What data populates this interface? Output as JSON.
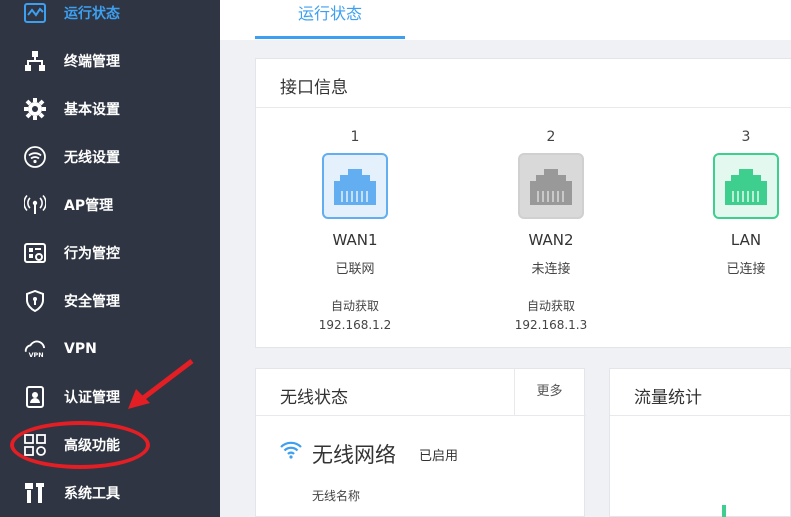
{
  "sidebar": {
    "items": [
      {
        "label": "运行状态",
        "icon": "chart-monitor-icon",
        "active": true
      },
      {
        "label": "终端管理",
        "icon": "network-tree-icon"
      },
      {
        "label": "基本设置",
        "icon": "gear-icon"
      },
      {
        "label": "无线设置",
        "icon": "wifi-icon"
      },
      {
        "label": "AP管理",
        "icon": "access-point-icon"
      },
      {
        "label": "行为管控",
        "icon": "behavior-control-icon"
      },
      {
        "label": "安全管理",
        "icon": "shield-icon"
      },
      {
        "label": "VPN",
        "icon": "vpn-cloud-icon"
      },
      {
        "label": "认证管理",
        "icon": "id-badge-icon"
      },
      {
        "label": "高级功能",
        "icon": "grid-apps-icon"
      },
      {
        "label": "系统工具",
        "icon": "tools-icon"
      }
    ]
  },
  "header": {
    "active_tab": "运行状态"
  },
  "interface_card": {
    "title": "接口信息",
    "ports": [
      {
        "number": "1",
        "name": "WAN1",
        "status": "已联网",
        "mode": "自动获取",
        "ip": "192.168.1.2",
        "state": "connected"
      },
      {
        "number": "2",
        "name": "WAN2",
        "status": "未连接",
        "mode": "自动获取",
        "ip": "192.168.1.3",
        "state": "disconnected"
      },
      {
        "number": "3",
        "name": "LAN",
        "status": "已连接",
        "state": "lan"
      }
    ]
  },
  "wireless_card": {
    "title": "无线状态",
    "more_label": "更多",
    "network_label": "无线网络",
    "network_status": "已启用",
    "ssid_label": "无线名称"
  },
  "traffic_card": {
    "title": "流量统计"
  },
  "colors": {
    "accent": "#3d9ff0",
    "sidebar_bg": "#2f3542",
    "wan1": "#62aef0",
    "wan2": "#999999",
    "lan": "#3ecf8e",
    "annotation": "#e31e24"
  }
}
